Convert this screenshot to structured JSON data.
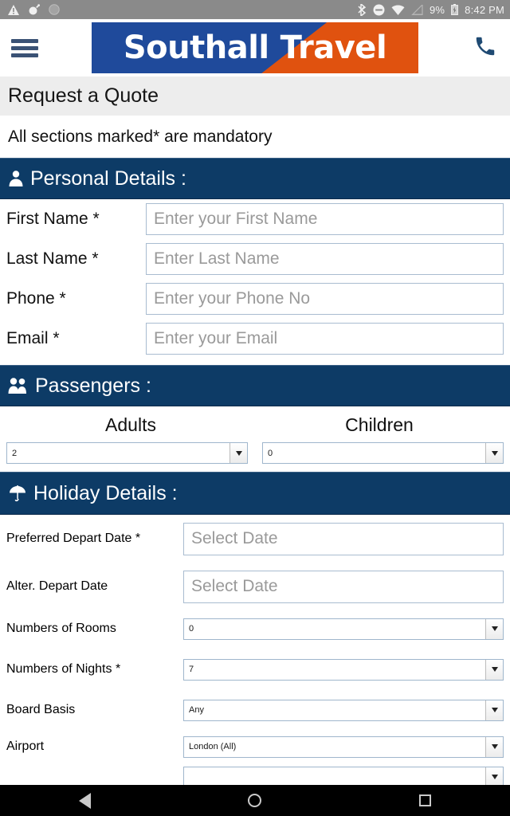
{
  "statusbar": {
    "time": "8:42 PM",
    "battery_pct": "9%",
    "left_icons": [
      "warning-icon",
      "bomb-icon",
      "circle-icon"
    ],
    "right_icons": [
      "bluetooth-icon",
      "do-not-disturb-icon",
      "wifi-icon",
      "signal-icon",
      "battery-icon"
    ]
  },
  "header": {
    "menu_icon": "hamburger-menu-icon",
    "phone_icon": "phone-icon",
    "logo_word1": "Southall",
    "logo_word2": "Travel",
    "logo_blue": "#1f4a9b",
    "logo_orange": "#e0520f"
  },
  "page": {
    "title": "Request a Quote",
    "mandatory_note": "All sections marked* are mandatory",
    "section_blue": "#0d3b66"
  },
  "personal": {
    "heading": "Personal Details :",
    "icon": "person-icon",
    "fields": [
      {
        "label": "First Name *",
        "placeholder": "Enter your First Name",
        "value": "",
        "name": "first-name"
      },
      {
        "label": "Last Name *",
        "placeholder": "Enter Last Name",
        "value": "",
        "name": "last-name"
      },
      {
        "label": "Phone *",
        "placeholder": "Enter your Phone No",
        "value": "",
        "name": "phone"
      },
      {
        "label": "Email *",
        "placeholder": "Enter your Email",
        "value": "",
        "name": "email"
      }
    ]
  },
  "passengers": {
    "heading": "Passengers :",
    "icon": "people-icon",
    "adults_label": "Adults",
    "children_label": "Children",
    "adults_value": "2",
    "children_value": "0"
  },
  "holiday": {
    "heading": "Holiday Details :",
    "icon": "umbrella-icon",
    "preferred_depart_label": "Preferred Depart Date *",
    "preferred_depart_placeholder": "Select Date",
    "alter_depart_label": "Alter. Depart Date",
    "alter_depart_placeholder": "Select Date",
    "rooms_label": "Numbers of Rooms",
    "rooms_value": "0",
    "nights_label": "Numbers of Nights *",
    "nights_value": "7",
    "board_label": "Board Basis",
    "board_value": "Any",
    "airport_label": "Airport",
    "airport_value": "London (All)"
  },
  "navbar": {
    "back": "back-icon",
    "home": "home-icon",
    "recents": "recents-icon"
  }
}
